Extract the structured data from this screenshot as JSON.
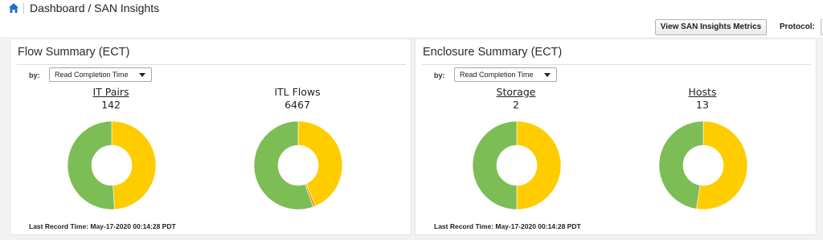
{
  "breadcrumb": {
    "text": "Dashboard / SAN Insights"
  },
  "toolbar": {
    "metrics_button": "View SAN Insights Metrics",
    "protocol_label": "Protocol:"
  },
  "colors": {
    "green": "#7cbd56",
    "yellow": "#ffcc00",
    "orange": "#f0a000",
    "home_blue": "#1d6fd1"
  },
  "panels": [
    {
      "title": "Flow Summary (ECT)",
      "by_label": "by:",
      "select_value": "Read Completion Time",
      "last_record": "Last Record Time: May-17-2020 00:14:28 PDT",
      "metrics": [
        {
          "title": "IT Pairs",
          "count": "142",
          "link": true,
          "fractions": {
            "yellow": 0.49,
            "orange": 0.0,
            "green": 0.51
          }
        },
        {
          "title": "ITL Flows",
          "count": "6467",
          "link": false,
          "fractions": {
            "yellow": 0.435,
            "orange": 0.01,
            "green": 0.555
          }
        }
      ]
    },
    {
      "title": "Enclosure Summary (ECT)",
      "by_label": "by:",
      "select_value": "Read Completion Time",
      "last_record": "Last Record Time: May-17-2020 00:14:28 PDT",
      "metrics": [
        {
          "title": "Storage",
          "count": "2",
          "link": true,
          "fractions": {
            "yellow": 0.5,
            "orange": 0.0,
            "green": 0.5
          }
        },
        {
          "title": "Hosts",
          "count": "13",
          "link": true,
          "fractions": {
            "yellow": 0.525,
            "orange": 0.0,
            "green": 0.475
          }
        }
      ]
    }
  ]
}
